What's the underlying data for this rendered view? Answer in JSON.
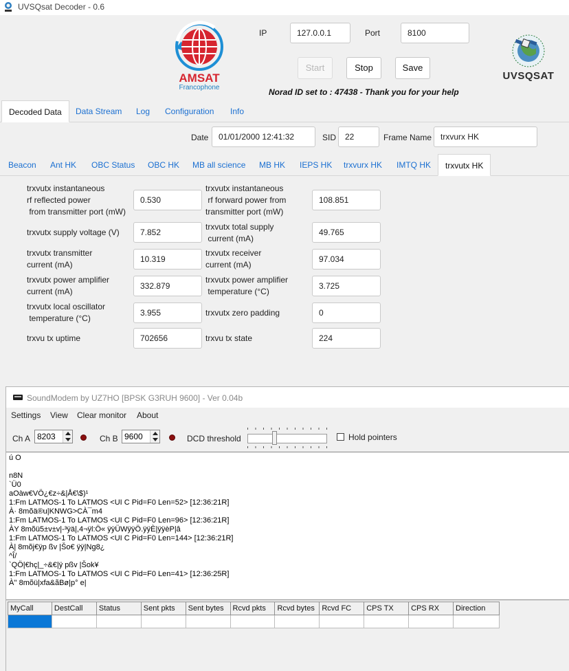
{
  "window": {
    "title": "UVSQsat Decoder - 0.6"
  },
  "logos": {
    "amsat_name": "AMSAT",
    "amsat_sub": "Francophone",
    "uvsq_name": "UVSQSAT"
  },
  "connection": {
    "ip_label": "IP",
    "ip_value": "127.0.0.1",
    "port_label": "Port",
    "port_value": "8100"
  },
  "buttons": {
    "start": "Start",
    "stop": "Stop",
    "save": "Save"
  },
  "norad_message": "Norad ID set to : 47438 - Thank you for your help",
  "main_tabs": [
    {
      "label": "Decoded Data",
      "active": true
    },
    {
      "label": "Data Stream",
      "active": false
    },
    {
      "label": "Log",
      "active": false
    },
    {
      "label": "Configuration",
      "active": false
    },
    {
      "label": "Info",
      "active": false
    }
  ],
  "frame_info": {
    "date_label": "Date",
    "date_value": "01/01/2000 12:41:32",
    "sid_label": "SID",
    "sid_value": "22",
    "frame_name_label": "Frame Name",
    "frame_name_value": "trxvurx HK"
  },
  "sub_tabs": [
    {
      "label": "Beacon",
      "active": false
    },
    {
      "label": "Ant HK",
      "active": false
    },
    {
      "label": "OBC Status",
      "active": false
    },
    {
      "label": "OBC HK",
      "active": false
    },
    {
      "label": "MB all science",
      "active": false
    },
    {
      "label": "MB HK",
      "active": false
    },
    {
      "label": "IEPS HK",
      "active": false
    },
    {
      "label": "trxvurx HK",
      "active": false
    },
    {
      "label": "IMTQ HK",
      "active": false
    },
    {
      "label": "trxvutx HK",
      "active": true
    }
  ],
  "fields": [
    {
      "label": "trxvutx instantaneous\nrf reflected power\n from transmitter port (mW)",
      "value": "0.530"
    },
    {
      "label": "trxvutx instantaneous\n rf forward power from\ntransmitter port (mW)",
      "value": "108.851"
    },
    {
      "label": "trxvutx supply voltage (V)",
      "value": "7.852"
    },
    {
      "label": "trxvutx total supply\n current (mA)",
      "value": "49.765"
    },
    {
      "label": "trxvutx transmitter\ncurrent (mA)",
      "value": "10.319"
    },
    {
      "label": "trxvutx receiver\ncurrent (mA)",
      "value": "97.034"
    },
    {
      "label": "trxvutx power amplifier\ncurrent (mA)",
      "value": "332.879"
    },
    {
      "label": "trxvutx power amplifier\n temperature (°C)",
      "value": "3.725"
    },
    {
      "label": "trxvutx local oscillator\n temperature (°C)",
      "value": "3.955"
    },
    {
      "label": "trxvutx zero padding",
      "value": "0"
    },
    {
      "label": "trxvu tx uptime",
      "value": "702656"
    },
    {
      "label": "trxvu tx state",
      "value": "224"
    }
  ],
  "soundmodem": {
    "title": "SoundModem by UZ7HO [BPSK G3RUH 9600] - Ver 0.04b",
    "menu": [
      "Settings",
      "View",
      "Clear monitor",
      "About"
    ],
    "cha_label": "Ch A",
    "cha_value": "8203",
    "chb_label": "Ch B",
    "chb_value": "9600",
    "dcd_label": "DCD threshold",
    "dcd_level": 0.33,
    "hold_label": "Hold pointers",
    "hold_checked": false,
    "monitor_lines": [
      "ú O",
      "",
      "n8N",
      "`Ü0",
      "aOàw€VÖ¿€z÷&|Å€\\$)¹",
      "1:Fm LATMOS-1 To LATMOS <UI C Pid=F0 Len=52> [12:36:21R]",
      "À· 8mõä®u|KNWG>CÀ¯m4",
      "1:Fm LATMOS-1 To LATMOS <UI C Pid=F0 Len=96> [12:36:21R]",
      "ÀY 8mõü5±v±v|-³ÿä|,4¬ÿl:Ö« ÿÿÜWÿÿÖ.ÿÿÈ|ÿÿèP|â",
      "1:Fm LATMOS-1 To LATMOS <UI C Pid=F0 Len=144> [12:36:21R]",
      "À| 8mõj€ÿp ßv |Šo€ ÿÿ|Ng8¿",
      "^Î/",
      "`QÖ|€hç|_÷&€|ÿ pßv |Šok¥",
      "1:Fm LATMOS-1 To LATMOS <UI C Pid=F0 Len=41> [12:36:25R]",
      "À'' 8mõü|xfa&ãBø|p° e|"
    ],
    "columns": [
      "MyCall",
      "DestCall",
      "Status",
      "Sent pkts",
      "Sent bytes",
      "Rcvd pkts",
      "Rcvd bytes",
      "Rcvd FC",
      "CPS TX",
      "CPS RX",
      "Direction"
    ]
  }
}
